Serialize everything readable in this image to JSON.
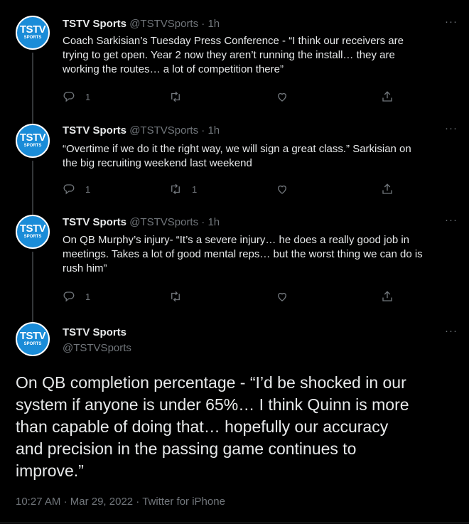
{
  "avatar": {
    "line1": "TSTV",
    "line2": "SPORTS"
  },
  "tweets": [
    {
      "name": "TSTV Sports",
      "handle": "@TSTVSports",
      "dot": "·",
      "time": "1h",
      "lines": [
        "Coach Sarkisian’s Tuesday Press Conference - “I think our receivers are",
        "trying to get open. Year 2 now they aren’t running the install… they are",
        "working the routes… a lot of competition there”"
      ],
      "reply_count": "1",
      "retweet_count": "",
      "like_count": ""
    },
    {
      "name": "TSTV Sports",
      "handle": "@TSTVSports",
      "dot": "·",
      "time": "1h",
      "lines": [
        "“Overtime if we do it the right way, we will sign a great class.” Sarkisian on",
        "the big recruiting weekend last weekend"
      ],
      "reply_count": "1",
      "retweet_count": "1",
      "like_count": ""
    },
    {
      "name": "TSTV Sports",
      "handle": "@TSTVSports",
      "dot": "·",
      "time": "1h",
      "lines": [
        "On QB Murphy’s injury- “It’s a severe injury… he does a really good job in",
        "meetings. Takes a lot of good mental reps… but the worst thing we can do is",
        "rush him”"
      ],
      "reply_count": "1",
      "retweet_count": "",
      "like_count": ""
    }
  ],
  "main_tweet": {
    "name": "TSTV Sports",
    "handle": "@TSTVSports",
    "lines": [
      "On QB completion percentage - “I’d be shocked in our",
      "system if anyone is under 65%… I think Quinn is more",
      "than capable of doing that… hopefully our accuracy",
      "and precision in the passing game continues to",
      "improve.”"
    ],
    "time": "10:27 AM",
    "date": "Mar 29, 2022",
    "source": "Twitter for iPhone",
    "sep": "·"
  },
  "more_label": "···",
  "icons": [
    "reply-icon",
    "retweet-icon",
    "like-icon",
    "share-icon",
    "more-icon"
  ],
  "colors": {
    "background": "#000000",
    "text": "#e7e9ea",
    "muted": "#71767b",
    "avatar": "#1a8cd8"
  }
}
